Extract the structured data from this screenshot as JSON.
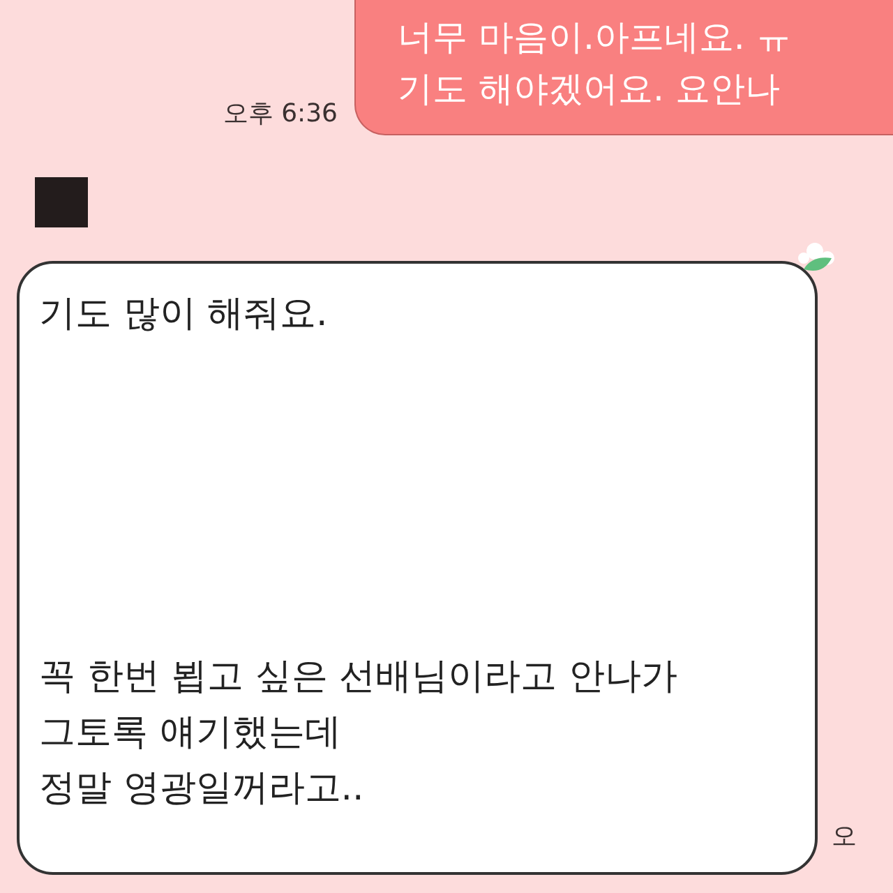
{
  "messages": [
    {
      "kind": "outgoing",
      "paragraphs": [
        [
          "너무 마음이.아프네요. ㅠ",
          "기도 해야겠어요. 요안나"
        ]
      ],
      "time": "오후 6:36"
    },
    {
      "kind": "incoming",
      "paragraphs": [
        [
          "기도 많이 해줘요."
        ],
        [
          "꼭 한번 뵙고 싶은 선배님이라고 안나가",
          "그토록 얘기했는데",
          "정말 영광일꺼라고.."
        ]
      ],
      "time": "오"
    }
  ]
}
